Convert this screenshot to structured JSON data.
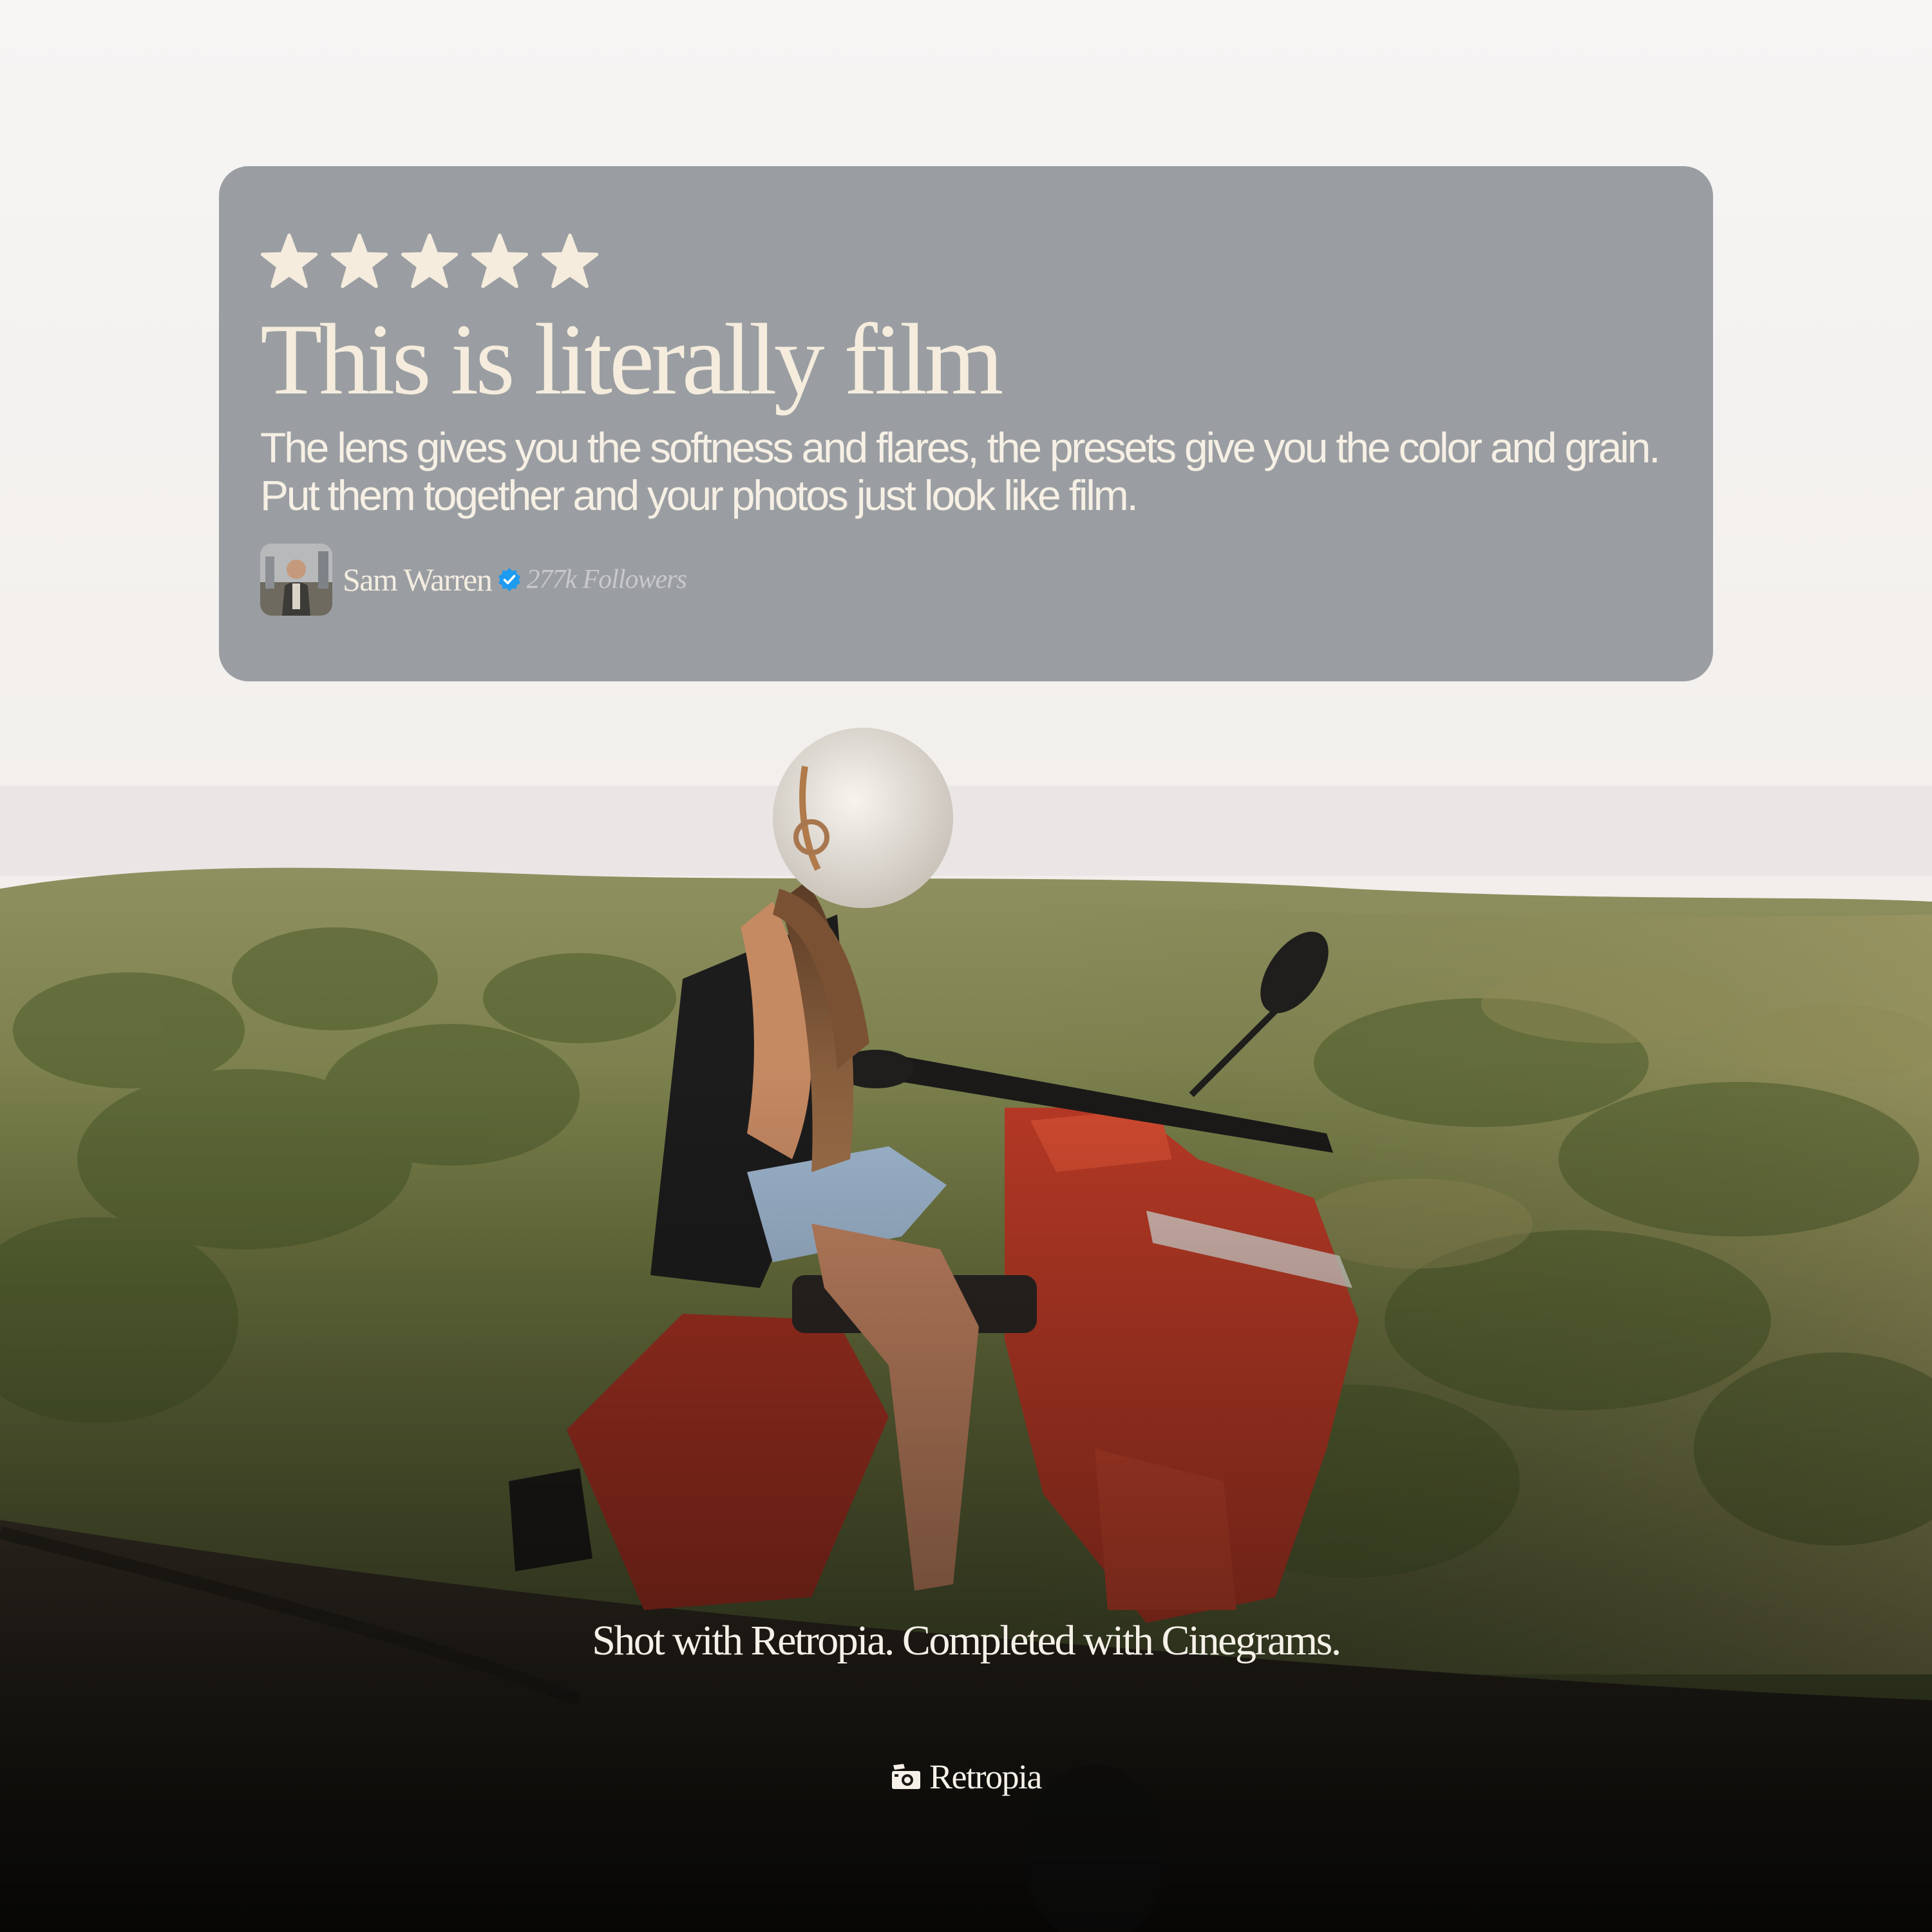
{
  "review": {
    "rating": 5,
    "star_color": "#f5ecdd",
    "headline": "This is literally film",
    "body": "The lens gives you the softness and flares, the presets give you the color and grain. Put them together and your photos just look like film.",
    "author_name": "Sam Warren",
    "verified_icon": "verified-badge-icon",
    "verified_color": "#1d9bf0",
    "followers": "277k Followers"
  },
  "caption": "Shot with Retropia. Completed with Cinegrams.",
  "brand": {
    "name": "Retropia",
    "icon": "camera-icon"
  }
}
